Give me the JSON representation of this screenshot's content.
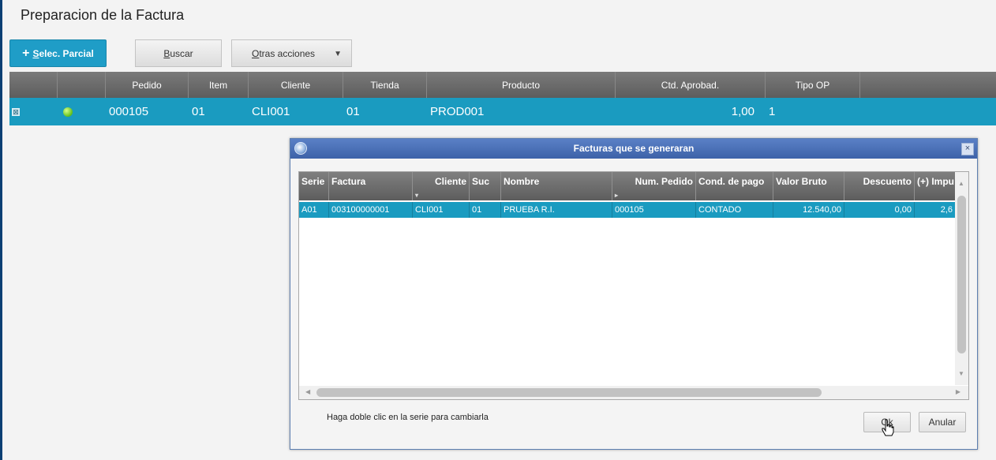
{
  "page": {
    "title": "Preparacion de la Factura"
  },
  "toolbar": {
    "selec_parcial_plus": "+",
    "selec_parcial_u": "S",
    "selec_parcial_rest": "elec. Parcial",
    "buscar_u": "B",
    "buscar_rest": "uscar",
    "otras_u": "O",
    "otras_rest": "tras acciones",
    "otras_caret": "▼"
  },
  "grid": {
    "columns": [
      "Pedido",
      "Item",
      "Cliente",
      "Tienda",
      "Producto",
      "Ctd. Aprobad.",
      "Tipo OP"
    ],
    "row": {
      "checkbox": "⊠",
      "pedido": "000105",
      "item": "01",
      "cliente": "CLI001",
      "tienda": "01",
      "producto": "PROD001",
      "ctd_aprobad": "1,00",
      "tipo_op": "1"
    }
  },
  "dialog": {
    "title": "Facturas que se generaran",
    "close_glyph": "×",
    "columns": [
      "Serie",
      "Factura",
      "Cliente",
      "Suc",
      "Nombre",
      "Num. Pedido",
      "Cond. de pago",
      "Valor Bruto",
      "Descuento",
      "(+) Impu"
    ],
    "row": {
      "serie": "A01",
      "factura": "003100000001",
      "cliente": "CLI001",
      "suc": "01",
      "nombre": "PRUEBA R.I.",
      "num_pedido": "000105",
      "cond_pago": "CONTADO",
      "valor_bruto": "12.540,00",
      "descuento": "0,00",
      "impu": "2,6"
    },
    "hint": "Haga doble clic en la serie para cambiarla",
    "ok_label": "Ok",
    "anular_label": "Anular"
  },
  "icons": {
    "status": "green-status-dot-icon",
    "app": "app-logo-icon",
    "cursor": "hand-pointer-icon"
  },
  "colors": {
    "accent": "#1f9dc7",
    "selected_row": "#1a9bc0",
    "header": "#6b6b6b",
    "dialog_title": "#4a70b8",
    "status_ok": "#5fbf1a"
  }
}
